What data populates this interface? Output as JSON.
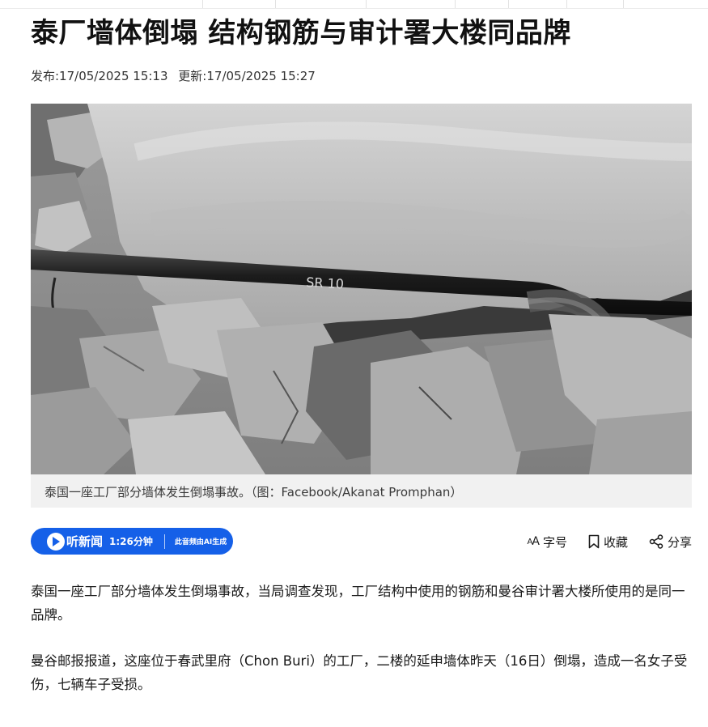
{
  "article": {
    "title": "泰厂墙体倒塌 结构钢筋与审计署大楼同品牌",
    "published": "发布:17/05/2025 15:13",
    "updated": "更新:17/05/2025 15:27",
    "image_caption": "泰国一座工厂部分墙体发生倒塌事故。（图：Facebook/Akanat Promphan）",
    "paragraphs": [
      "泰国一座工厂部分墙体发生倒塌事故，当局调查发现，工厂结构中使用的钢筋和曼谷审计署大楼所使用的是同一品牌。",
      "曼谷邮报报道，这座位于春武里府（Chon Buri）的工厂，二楼的延申墙体昨天（16日）倒塌，造成一名女子受伤，七辆车子受损。"
    ]
  },
  "listen_bar": {
    "label": "听新闻",
    "duration": "1:26分钟",
    "ai_note": "此音频由AI生成",
    "icon": "play-icon",
    "color": "#1560e8"
  },
  "toolbar": {
    "font_size_label": "字号",
    "font_size_icon_text": "AA",
    "bookmark_label": "收藏",
    "share_label": "分享"
  }
}
